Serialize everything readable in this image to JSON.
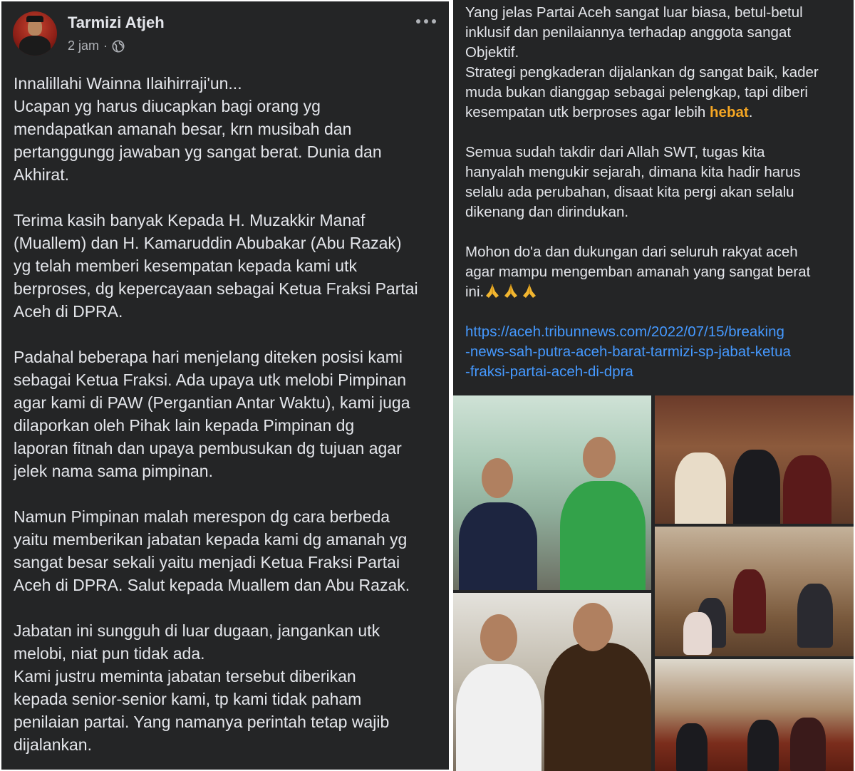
{
  "left": {
    "author": "Tarmizi Atjeh",
    "time": "2 jam",
    "separator": "·",
    "paragraphs": [
      [
        "Innalillahi Wainna Ilaihirraji'un...",
        "Ucapan yg harus diucapkan bagi orang yg",
        "mendapatkan amanah besar, krn musibah dan",
        "pertanggungg jawaban yg sangat berat. Dunia dan",
        "Akhirat."
      ],
      [
        "Terima kasih banyak Kepada H. Muzakkir Manaf",
        "(Muallem) dan H. Kamaruddin Abubakar (Abu Razak)",
        "yg telah memberi kesempatan kepada kami utk",
        "berproses, dg kepercayaan sebagai Ketua Fraksi Partai",
        "Aceh di DPRA."
      ],
      [
        "Padahal beberapa hari menjelang diteken posisi kami",
        "sebagai Ketua Fraksi. Ada upaya utk melobi Pimpinan",
        "agar kami di PAW (Pergantian Antar Waktu), kami juga",
        "dilaporkan oleh Pihak lain kepada Pimpinan dg",
        "laporan fitnah dan upaya pembusukan dg tujuan agar",
        "jelek nama sama pimpinan."
      ],
      [
        "Namun Pimpinan malah merespon dg cara berbeda",
        "yaitu memberikan jabatan kepada kami dg amanah yg",
        "sangat besar sekali yaitu menjadi Ketua Fraksi Partai",
        "Aceh di DPRA. Salut kepada Muallem dan Abu Razak."
      ],
      [
        "Jabatan ini sungguh di luar dugaan, jangankan utk",
        "melobi, niat pun tidak ada.",
        "Kami justru meminta jabatan tersebut diberikan",
        "kepada senior-senior kami, tp kami tidak paham",
        "penilaian partai. Yang namanya perintah tetap wajib",
        "dijalankan."
      ]
    ]
  },
  "right": {
    "para1": [
      "Yang jelas Partai Aceh sangat luar biasa, betul-betul",
      "inklusif dan penilaiannya terhadap anggota sangat",
      "Objektif.",
      "Strategi pengkaderan dijalankan dg sangat baik, kader",
      "muda bukan dianggap sebagai pelengkap, tapi diberi"
    ],
    "para1_last_prefix": "kesempatan utk berproses agar lebih ",
    "para1_highlight": "hebat",
    "para1_last_suffix": ".",
    "para2": [
      "Semua sudah takdir dari Allah SWT, tugas kita",
      "hanyalah mengukir sejarah, dimana kita hadir harus",
      "selalu ada perubahan, disaat kita pergi akan selalu",
      "dikenang dan dirindukan."
    ],
    "para3": [
      "Mohon do'a dan dukungan dari seluruh rakyat aceh",
      "agar mampu mengemban amanah yang sangat berat"
    ],
    "para3_last": "ini.",
    "link_lines": [
      "https://aceh.tribunnews.com/2022/07/15/breaking",
      "-news-sah-putra-aceh-barat-tarmizi-sp-jabat-ketua",
      "-fraksi-partai-aceh-di-dpra"
    ]
  },
  "colors": {
    "background": "#242526",
    "text": "#e4e6eb",
    "muted": "#b0b3b8",
    "link": "#4599ff",
    "highlight": "#f5a623"
  },
  "icons": [
    "globe-icon",
    "more-options-icon",
    "folded-hands-emoji"
  ]
}
